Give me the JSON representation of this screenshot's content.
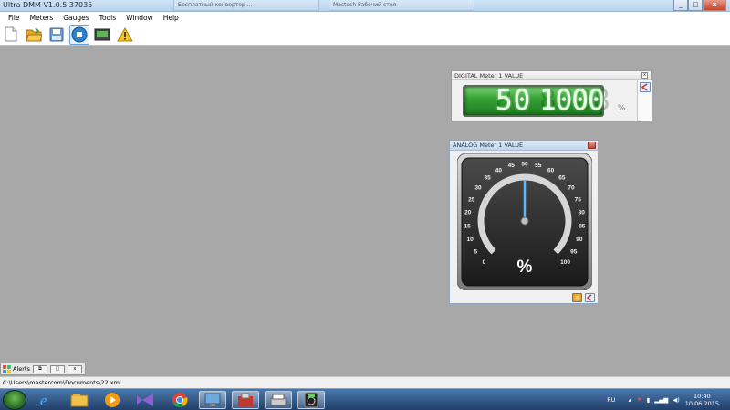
{
  "window": {
    "title": "Ultra DMM V1.0.5.37035",
    "bg_tabs": [
      "Бесплатный конвертер ...",
      "Mastech Рабочий стол"
    ],
    "minimize": "_",
    "maximize": "□",
    "close": "x"
  },
  "menu": [
    "File",
    "Meters",
    "Gauges",
    "Tools",
    "Window",
    "Help"
  ],
  "toolbar": {
    "icons": [
      "new-file-icon",
      "open-folder-icon",
      "save-icon",
      "stop-icon",
      "meter-display-icon",
      "warning-icon"
    ]
  },
  "digital_meter": {
    "title": "DIGITAL Meter 1 VALUE",
    "value_left": "50",
    "value_right": "1000",
    "unit": "%"
  },
  "analog_meter": {
    "title": "ANALOG Meter 1 VALUE",
    "ticks": [
      "0",
      "5",
      "10",
      "15",
      "20",
      "25",
      "30",
      "35",
      "40",
      "45",
      "50",
      "55",
      "60",
      "65",
      "70",
      "75",
      "80",
      "85",
      "90",
      "95",
      "100"
    ],
    "value": 50,
    "unit": "%"
  },
  "alerts": {
    "label": "Alerts"
  },
  "statusbar": {
    "path": "C:\\Users\\mastercom\\Documents\\22.xml"
  },
  "taskbar": {
    "language": "RU",
    "time": "10:40",
    "date": "10.06.2015",
    "apps": [
      "explorer-icon",
      "internet-explorer-icon",
      "file-explorer-icon",
      "media-player-icon",
      "visual-studio-icon",
      "chrome-icon",
      "remote-desktop-icon",
      "tool-icon",
      "scanner-icon",
      "ultra-dmm-icon"
    ]
  },
  "colors": {
    "lcd_green": "#2f9a2f",
    "needle_blue": "#5bb8ff",
    "workspace": "#a8a8a8"
  }
}
